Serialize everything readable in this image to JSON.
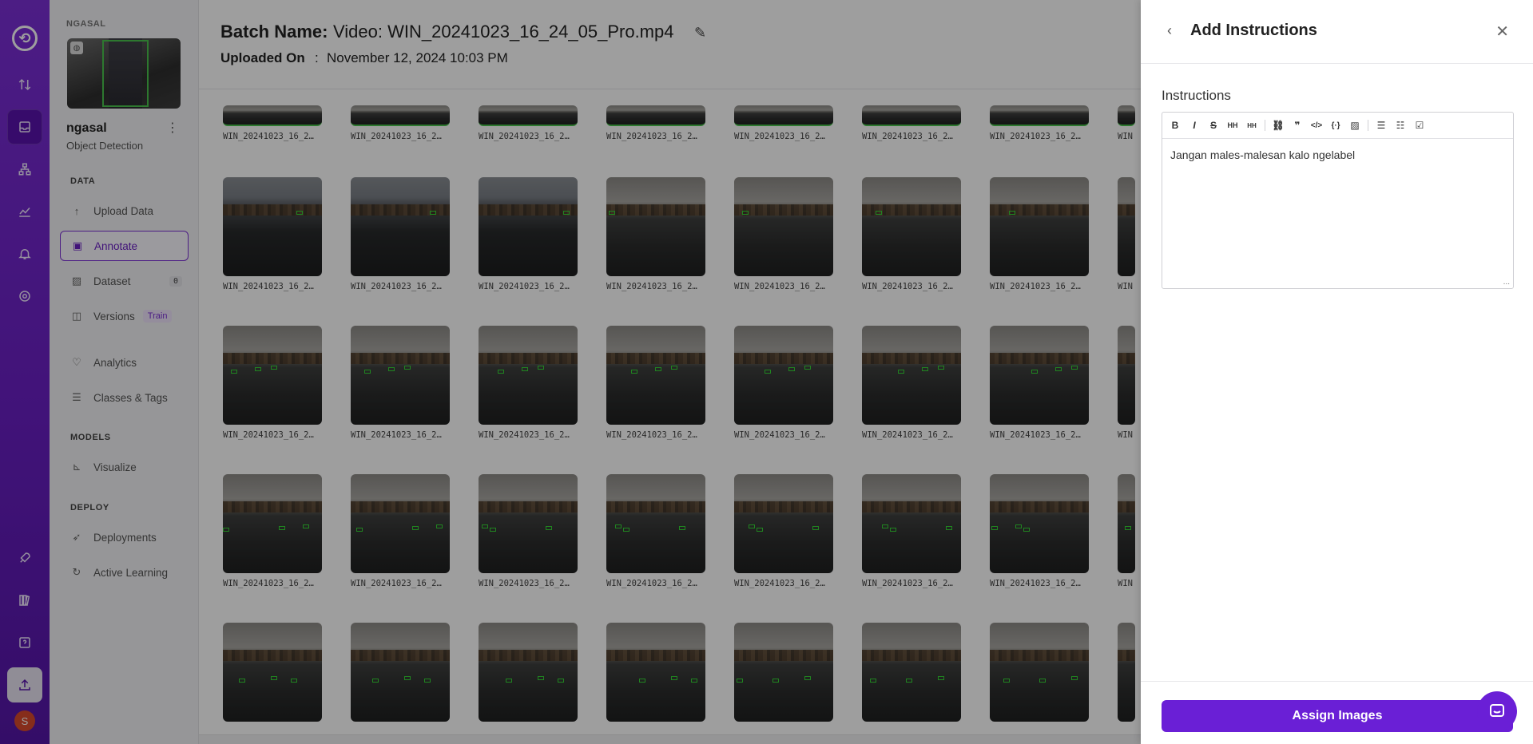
{
  "rail": {
    "icons": [
      "logo-icon",
      "transfer-icon",
      "inbox-icon",
      "hierarchy-icon",
      "analytics-icon",
      "bell-icon",
      "settings-icon",
      "rocket-icon",
      "book-icon",
      "help-icon",
      "upload-icon"
    ],
    "avatar_letter": "S"
  },
  "sidebar": {
    "workspace_label": "NGASAL",
    "project_name": "ngasal",
    "project_type": "Object Detection",
    "sections": {
      "data": "DATA",
      "models": "MODELS",
      "deploy": "DEPLOY"
    },
    "items": {
      "upload": "Upload Data",
      "annotate": "Annotate",
      "dataset": "Dataset",
      "dataset_count": "0",
      "versions": "Versions",
      "versions_badge": "Train",
      "analytics": "Analytics",
      "classes": "Classes & Tags",
      "visualize": "Visualize",
      "deployments": "Deployments",
      "active_learning": "Active Learning"
    }
  },
  "header": {
    "batch_label": "Batch Name:",
    "batch_value": "Video: WIN_20241023_16_24_05_Pro.mp4",
    "uploaded_label": "Uploaded On",
    "uploaded_colon": ":",
    "uploaded_value": "November 12, 2024 10:03 PM"
  },
  "grid": {
    "caption": "WIN_20241023_16_2…",
    "caption_partial": "WIN"
  },
  "drawer": {
    "title": "Add Instructions",
    "instructions_label": "Instructions",
    "instructions_text": "Jangan males-malesan kalo ngelabel",
    "resize_grip": "...",
    "assign_button": "Assign Images",
    "toolbar": [
      "bold",
      "italic",
      "strikethrough",
      "heading",
      "heading-small",
      "link",
      "quote",
      "code",
      "code-block",
      "image",
      "bulleted-list",
      "numbered-list",
      "task-list"
    ]
  }
}
